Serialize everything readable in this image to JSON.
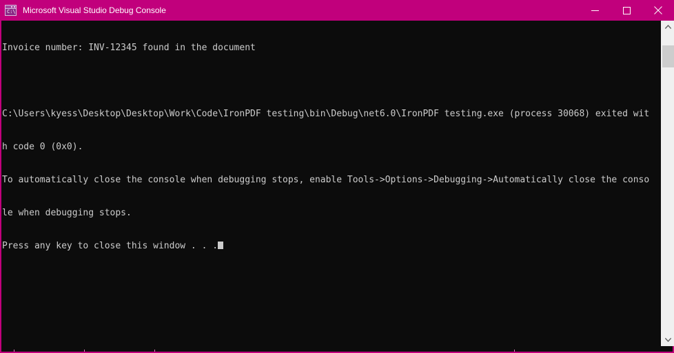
{
  "window": {
    "title": "Microsoft Visual Studio Debug Console",
    "icon_name": "console-app-icon",
    "icon_text": "C:\\",
    "titlebar_color": "#c1007c",
    "console_background": "#0c0c0c",
    "console_foreground": "#cccccc"
  },
  "controls": {
    "minimize_label": "Minimize",
    "maximize_label": "Maximize",
    "close_label": "Close"
  },
  "console": {
    "lines": [
      "Invoice number: INV-12345 found in the document",
      "",
      "C:\\Users\\kyess\\Desktop\\Desktop\\Work\\Code\\IronPDF testing\\bin\\Debug\\net6.0\\IronPDF testing.exe (process 30068) exited wit",
      "h code 0 (0x0).",
      "To automatically close the console when debugging stops, enable Tools->Options->Debugging->Automatically close the conso",
      "le when debugging stops.",
      "Press any key to close this window . . ."
    ],
    "cursor_visible": "true"
  },
  "scrollbar": {
    "up_arrow": "˄",
    "down_arrow": "˅",
    "thumb_top_px": "18",
    "thumb_height_px": "32"
  }
}
